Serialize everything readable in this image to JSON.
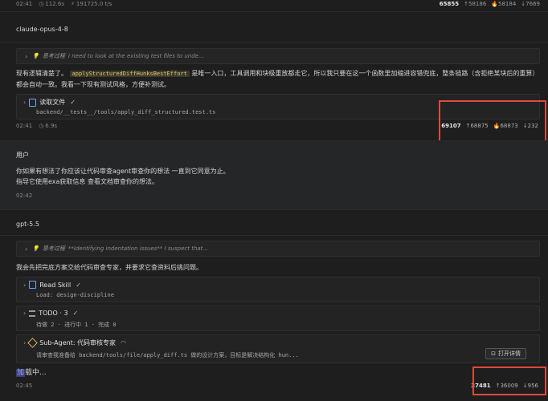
{
  "top": {
    "time": "02:41",
    "duration": "112.6s",
    "speed": "191725.0 t/s",
    "tokens": "65855",
    "up": "58186",
    "fire": "58184",
    "down": "7669"
  },
  "msg1": {
    "model": "claude-opus-4-8",
    "thinking_label": "思考过程",
    "thinking_text": "I need to look at the existing test files to unde...",
    "para_pre": "现有逻辑清楚了。",
    "para_code": "applyStructuredDiffHunksBestEffort",
    "para_post": " 是唯一入口，工具调用和块级重放都走它，所以我只要在这一个函数里加缩进容错兜底，整条链路（含拒绝某块后的重算）都会自动一致。我看一下现有测试风格，方便补测试。",
    "tool": {
      "title": "读取文件",
      "path": "backend/__tests__/tools/apply_diff_structured.test.ts"
    },
    "meta": {
      "time": "02:41",
      "duration": "6.9s"
    },
    "stats": {
      "tokens": "69107",
      "up": "68875",
      "fire": "68873",
      "down": "232"
    }
  },
  "user": {
    "label": "用户",
    "line1": "你如果有想法了你应该让代码审查agent审查你的想法 一直到它同意为止。",
    "line2": "指导它使用exa获取信息 查看文档审查你的想法。",
    "time": "02:42"
  },
  "msg2": {
    "model": "gpt-5.5",
    "thinking_label": "思考过程",
    "thinking_text": "**Identifying indentation issues** I suspect that...",
    "para": "我会先把完底方案交给代码审查专家，并要求它查资料后挑问题。",
    "tool1": {
      "title": "Read Skill",
      "sub": "Load: design-discipline"
    },
    "tool2": {
      "title": "TODO · 3",
      "sub": "待做 2 · 进行中 1 · 完成 0"
    },
    "tool3": {
      "title": "Sub-Agent: 代码审核专家",
      "sub": "请审查我准备给 backend/tools/file/apply_diff.ts 做的设计方案，目标是解决结构化 hun...",
      "button": "打开详情"
    },
    "loading_accent": "加",
    "loading_rest": "载中...",
    "meta": {
      "time": "02:45"
    },
    "stats": {
      "tokens": "37481",
      "up": "36009",
      "down": "956"
    }
  }
}
